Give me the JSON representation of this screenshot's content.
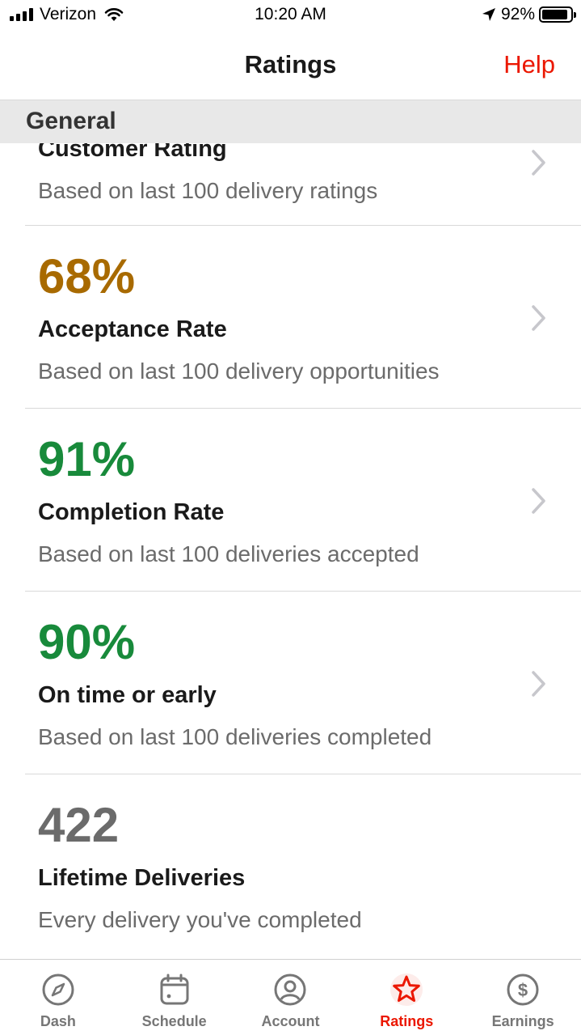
{
  "status_bar": {
    "carrier": "Verizon",
    "time": "10:20 AM",
    "battery_percent": "92%",
    "battery_level": 0.92
  },
  "nav": {
    "title": "Ratings",
    "help_label": "Help"
  },
  "section": {
    "title": "General"
  },
  "rows": [
    {
      "metric": "",
      "title": "Customer Rating",
      "subtitle": "Based on last 100 delivery ratings",
      "metric_color": "#1a1a1a"
    },
    {
      "metric": "68%",
      "title": "Acceptance Rate",
      "subtitle": "Based on last 100 delivery opportunities",
      "metric_color": "#a86a00"
    },
    {
      "metric": "91%",
      "title": "Completion Rate",
      "subtitle": "Based on last 100 deliveries accepted",
      "metric_color": "#188a3b"
    },
    {
      "metric": "90%",
      "title": "On time or early",
      "subtitle": "Based on last 100 deliveries completed",
      "metric_color": "#188a3b"
    },
    {
      "metric": "422",
      "title": "Lifetime Deliveries",
      "subtitle": "Every delivery you've completed",
      "metric_color": "#6b6b6b"
    }
  ],
  "tabs": [
    {
      "label": "Dash",
      "icon": "compass-icon",
      "active": false
    },
    {
      "label": "Schedule",
      "icon": "calendar-icon",
      "active": false
    },
    {
      "label": "Account",
      "icon": "user-circle-icon",
      "active": false
    },
    {
      "label": "Ratings",
      "icon": "star-icon",
      "active": true
    },
    {
      "label": "Earnings",
      "icon": "dollar-circle-icon",
      "active": false
    }
  ],
  "colors": {
    "accent": "#eb1700",
    "tab_inactive": "#767676",
    "divider": "#d9d9d9",
    "section_bg": "#e8e8e8"
  }
}
